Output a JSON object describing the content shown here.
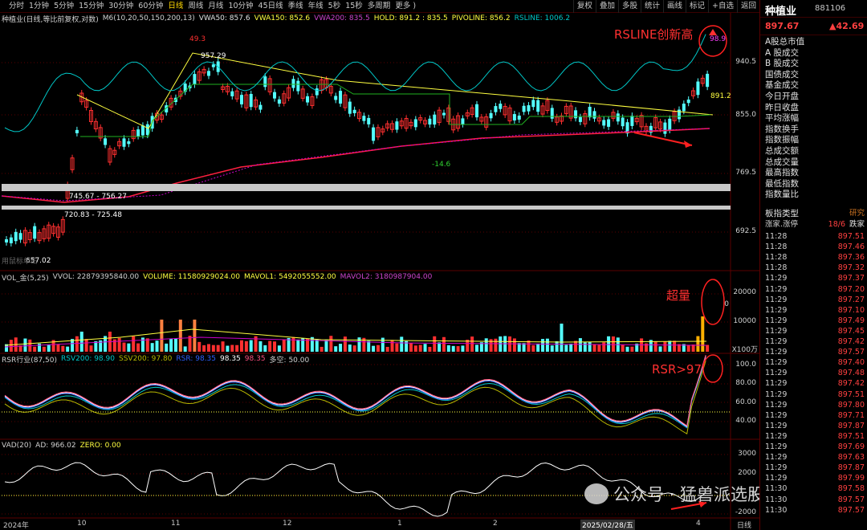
{
  "toolbar": {
    "periods": [
      "分时",
      "1分钟",
      "5分钟",
      "15分钟",
      "30分钟",
      "60分钟",
      "日线",
      "周线",
      "月线",
      "10分钟",
      "45日线",
      "季线",
      "年线",
      "5秒",
      "15秒",
      "多周期",
      "更多 )"
    ],
    "active_period": "日线",
    "tools": [
      "复权",
      "叠加",
      "多股",
      "统计",
      "画线",
      "标记",
      "+自选",
      "返回"
    ]
  },
  "header": {
    "name": "种植业(日线,等比前复权,对数)",
    "ma": "M6(10,20,50,150,200,13)",
    "vwa50": "VWA50: 857.6",
    "vwa150": "VWA150: 852.6",
    "vwa200": "VWA200: 835.5",
    "hold": "HOLD: 891.2 : 835.5",
    "pivoline": "PIVOLINE: 856.2",
    "rsline": "RSLINE: 1006.2"
  },
  "vol_header": {
    "name": "VOL_金(5,25)",
    "vvol": "VVOL: 22879395840.00",
    "volume": "VOLUME: 11580929024.00",
    "mavol1": "MAVOL1: 5492055552.00",
    "mavol2": "MAVOL2: 3180987904.00"
  },
  "rsr_header": {
    "name": "RSR行业(87,50)",
    "rsv200": "RSV200: 98.90",
    "ssv200": "SSV200: 97.80",
    "rsr": "RSR: 98.35",
    "v1": "98.35",
    "v2": "98.35",
    "duo": "多空: 50.00"
  },
  "vad_header": {
    "name": "VAD(20)",
    "ad": "AD: 966.02",
    "zero": "ZERO: 0.00"
  },
  "price_axis": [
    "940.5",
    "855.0",
    "769.5",
    "692.5"
  ],
  "vol_axis": [
    "20000",
    "10000",
    "0",
    "X100万"
  ],
  "rsr_axis": [
    "100.0",
    "80.00",
    "60.00",
    "40.00"
  ],
  "vad_axis": [
    "3000",
    "2000",
    "0",
    "-2000"
  ],
  "x_axis": {
    "labels": [
      "2024年",
      "10",
      "11",
      "12",
      "1",
      "2",
      "2025/02/28/五",
      "4"
    ],
    "right": "日线"
  },
  "annotations": {
    "peak": "49.3",
    "high": "957.29",
    "low_label": "-14.6",
    "hold": "891.2",
    "rsline_tag": "98.9",
    "band1": "745.67 - 756.27",
    "band2": "720.83 - 725.48",
    "start": "657.02",
    "rsline_new_high": "RSLINE创新高",
    "super_volume": "超量",
    "rsr_gt_97": "RSR>97",
    "watermark": "公众号 · 猛兽派选股",
    "left_watermark": "用鼠标单击"
  },
  "quote": {
    "name": "种植业",
    "code": "881106",
    "price": "897.67",
    "change": "▲42.69",
    "menu": [
      "A股总市值",
      "A 股成交",
      "B 股成交",
      "国债成交",
      "基金成交",
      "今日开盘",
      "昨日收盘",
      "平均涨幅",
      "指数换手",
      "指数振幅",
      "总成交额",
      "总成交量",
      "最高指数",
      "最低指数",
      "指数量比",
      "板指类型"
    ],
    "type_value": "研究",
    "limit_label": "涨家.涨停",
    "limit_value": "18/6",
    "limit_extra": "跌家"
  },
  "ticks": [
    [
      "11:28",
      "897.51"
    ],
    [
      "11:28",
      "897.46"
    ],
    [
      "11:28",
      "897.36"
    ],
    [
      "11:28",
      "897.32"
    ],
    [
      "11:29",
      "897.37"
    ],
    [
      "11:29",
      "897.20"
    ],
    [
      "11:29",
      "897.27"
    ],
    [
      "11:29",
      "897.10"
    ],
    [
      "11:29",
      "897.49"
    ],
    [
      "11:29",
      "897.45"
    ],
    [
      "11:29",
      "897.42"
    ],
    [
      "11:29",
      "897.57"
    ],
    [
      "11:29",
      "897.40"
    ],
    [
      "11:29",
      "897.48"
    ],
    [
      "11:29",
      "897.42"
    ],
    [
      "11:29",
      "897.51"
    ],
    [
      "11:29",
      "897.80"
    ],
    [
      "11:29",
      "897.71"
    ],
    [
      "11:29",
      "897.87"
    ],
    [
      "11:29",
      "897.51"
    ],
    [
      "11:29",
      "897.69"
    ],
    [
      "11:29",
      "897.63"
    ],
    [
      "11:29",
      "897.87"
    ],
    [
      "11:29",
      "897.99"
    ],
    [
      "11:30",
      "897.58"
    ],
    [
      "11:30",
      "897.57"
    ],
    [
      "11:30",
      "897.57"
    ]
  ],
  "colors": {
    "up": "#ff3030",
    "down": "#54ffff",
    "ma_yellow": "#ffff40",
    "ma_green": "#20b020",
    "vwa200": "#cc00cc",
    "rsline": "#00c8c8",
    "accent": "#ff3030"
  }
}
